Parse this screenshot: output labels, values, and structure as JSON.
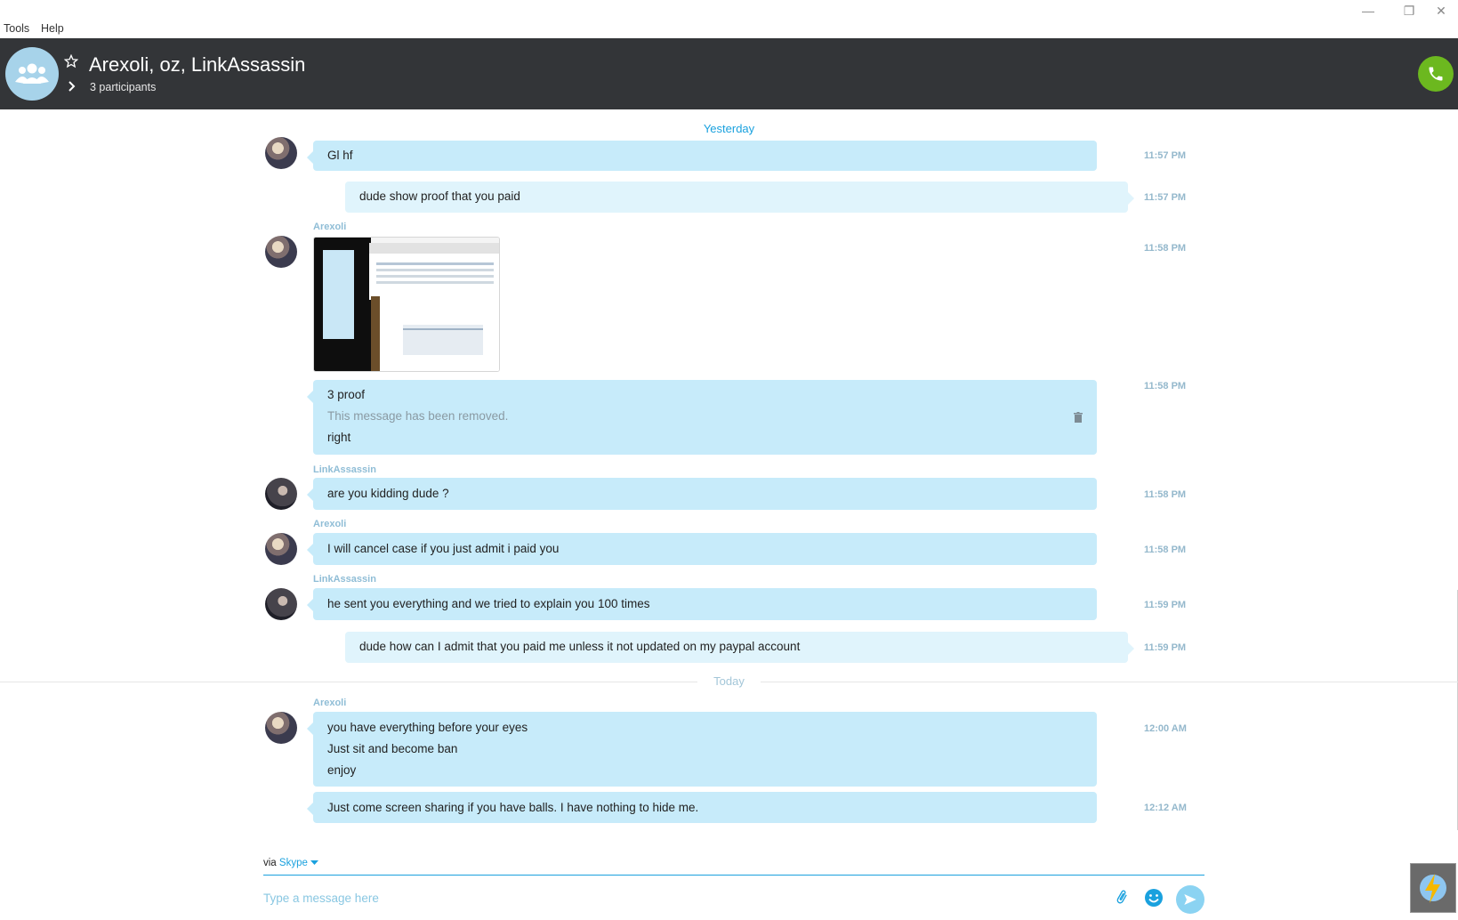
{
  "menu": {
    "tools": "Tools",
    "help": "Help"
  },
  "window_controls": {
    "minimize": "—",
    "restore": "❐",
    "close": "✕"
  },
  "header": {
    "title": "Arexoli, oz, LinkAssassin",
    "participants": "3 participants"
  },
  "chat": {
    "day_yesterday": "Yesterday",
    "day_today": "Today",
    "messages": [
      {
        "sender": "",
        "lines": [
          "Gl hf"
        ],
        "time": "11:57 PM"
      },
      {
        "sender": "",
        "lines": [
          "dude show proof that you paid"
        ],
        "time": "11:57 PM"
      },
      {
        "sender": "Arexoli",
        "lines": [],
        "time": "11:58 PM"
      },
      {
        "sender": "",
        "lines": [
          "3 proof",
          "This message has been removed.",
          "right"
        ],
        "time": "11:58 PM"
      },
      {
        "sender": "LinkAssassin",
        "lines": [
          "are you kidding dude ?"
        ],
        "time": "11:58 PM"
      },
      {
        "sender": "Arexoli",
        "lines": [
          "I will cancel case if you just admit i paid you"
        ],
        "time": "11:58 PM"
      },
      {
        "sender": "LinkAssassin",
        "lines": [
          "he sent you everything and we tried to explain you 100 times"
        ],
        "time": "11:59 PM"
      },
      {
        "sender": "",
        "lines": [
          "dude how can I admit that you paid me unless it not updated on my paypal account"
        ],
        "time": "11:59 PM"
      },
      {
        "sender": "Arexoli",
        "lines": [
          "you have everything before your eyes",
          "Just sit and become ban",
          "enjoy"
        ],
        "time": "12:00 AM"
      },
      {
        "sender": "",
        "lines": [
          "Just come screen sharing if you have balls. I have nothing to hide me."
        ],
        "time": "12:12 AM"
      }
    ]
  },
  "composer": {
    "via": "via",
    "via_service": "Skype",
    "placeholder": "Type a message here"
  },
  "colors": {
    "header_bg": "#333538",
    "incoming_bubble": "#c7ebfa",
    "outgoing_bubble": "#e0f4fc",
    "accent": "#1aa1de",
    "call_green": "#6cb81f"
  }
}
